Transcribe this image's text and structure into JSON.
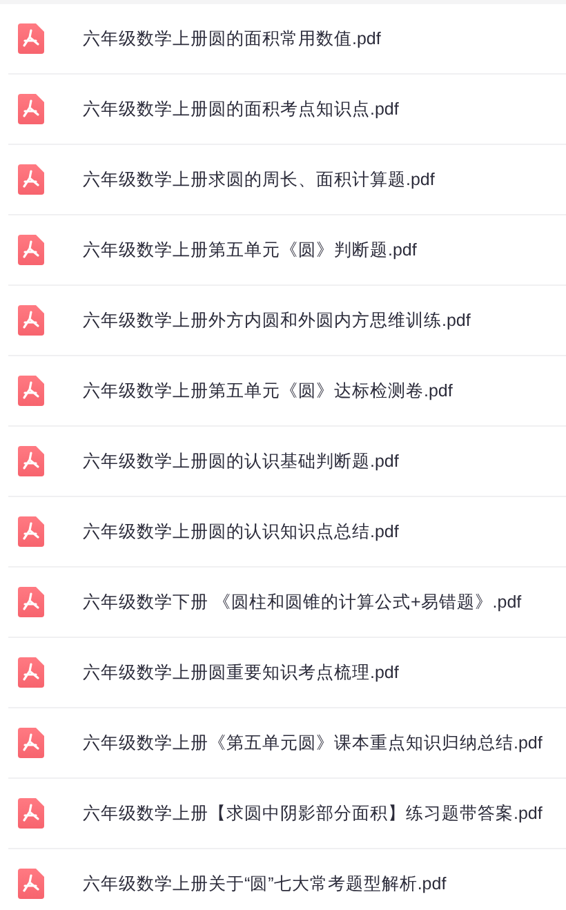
{
  "files": [
    {
      "name": "六年级数学上册圆的面积常用数值.pdf"
    },
    {
      "name": "六年级数学上册圆的面积考点知识点.pdf"
    },
    {
      "name": "六年级数学上册求圆的周长、面积计算题.pdf"
    },
    {
      "name": "六年级数学上册第五单元《圆》判断题.pdf"
    },
    {
      "name": "六年级数学上册外方内圆和外圆内方思维训练.pdf"
    },
    {
      "name": "六年级数学上册第五单元《圆》达标检测卷.pdf"
    },
    {
      "name": "六年级数学上册圆的认识基础判断题.pdf"
    },
    {
      "name": "六年级数学上册圆的认识知识点总结.pdf"
    },
    {
      "name": "六年级数学下册 《圆柱和圆锥的计算公式+易错题》.pdf"
    },
    {
      "name": "六年级数学上册圆重要知识考点梳理.pdf"
    },
    {
      "name": "六年级数学上册《第五单元圆》课本重点知识归纳总结.pdf"
    },
    {
      "name": "六年级数学上册【求圆中阴影部分面积】练习题带答案.pdf"
    },
    {
      "name": "六年级数学上册关于“圆”七大常考题型解析.pdf"
    }
  ]
}
